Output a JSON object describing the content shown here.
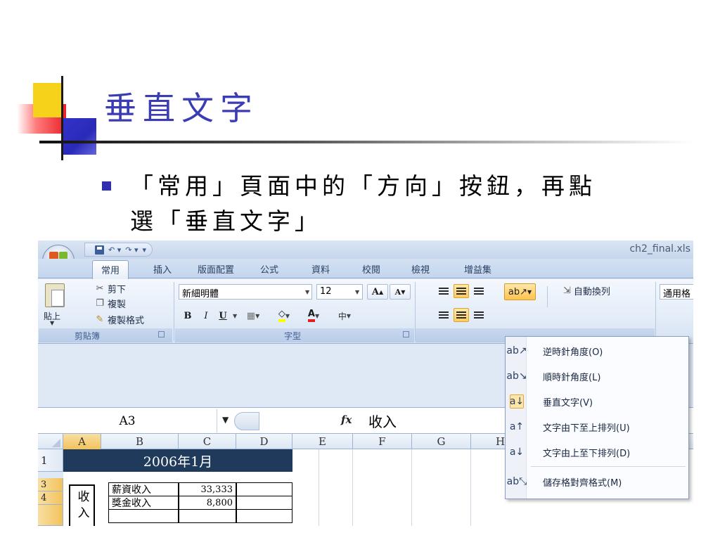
{
  "slide": {
    "title": "垂直文字",
    "bullet_line1": "「常用」頁面中的「方向」按鈕，再點",
    "bullet_line2": "選「垂直文字」"
  },
  "excel": {
    "window_title": "ch2_final.xls",
    "qat": {
      "undo": "↶ ▾",
      "redo": "↷ ▾",
      "customize": "▾"
    },
    "tabs": [
      "常用",
      "插入",
      "版面配置",
      "公式",
      "資料",
      "校閱",
      "檢視",
      "增益集"
    ],
    "clipboard": {
      "paste": "貼上",
      "cut": "剪下",
      "copy": "複製",
      "format_painter": "複製格式",
      "group_label": "剪貼簿"
    },
    "font": {
      "name": "新細明體",
      "size": "12",
      "grow": "A",
      "shrink": "A",
      "bold": "B",
      "italic": "I",
      "underline": "U",
      "phonetic": "中",
      "group_label": "字型"
    },
    "alignment": {
      "wrap_text": "自動換列"
    },
    "number": {
      "format": "通用格"
    },
    "name_box": "A3",
    "fx": "fx",
    "formula_value": "收入",
    "columns": [
      "A",
      "B",
      "C",
      "D",
      "E",
      "F",
      "G",
      "H"
    ],
    "rows": [
      "1",
      "3",
      "4"
    ],
    "sheet": {
      "title": "2006年1月",
      "merged_label": "收入",
      "items": [
        {
          "label": "薪資收入",
          "value": "33,333"
        },
        {
          "label": "獎金收入",
          "value": "8,800"
        }
      ]
    },
    "orientation_menu": [
      {
        "icon": "rotate-counterclockwise-icon",
        "glyph": "ab↗",
        "label": "逆時針角度(O)"
      },
      {
        "icon": "rotate-clockwise-icon",
        "glyph": "ab↘",
        "label": "順時針角度(L)"
      },
      {
        "icon": "vertical-text-icon",
        "glyph": "a↓",
        "label": "垂直文字(V)",
        "checked": true
      },
      {
        "icon": "rotate-up-icon",
        "glyph": "a↑",
        "label": "文字由下至上排列(U)"
      },
      {
        "icon": "rotate-down-icon",
        "glyph": "a↓",
        "label": "文字由上至下排列(D)"
      },
      {
        "icon": "format-alignment-icon",
        "glyph": "ab⤡",
        "label": "儲存格對齊格式(M)"
      }
    ],
    "colors": {
      "title_fill": "#1f3a5a",
      "highlight": "#ffc24d"
    }
  }
}
